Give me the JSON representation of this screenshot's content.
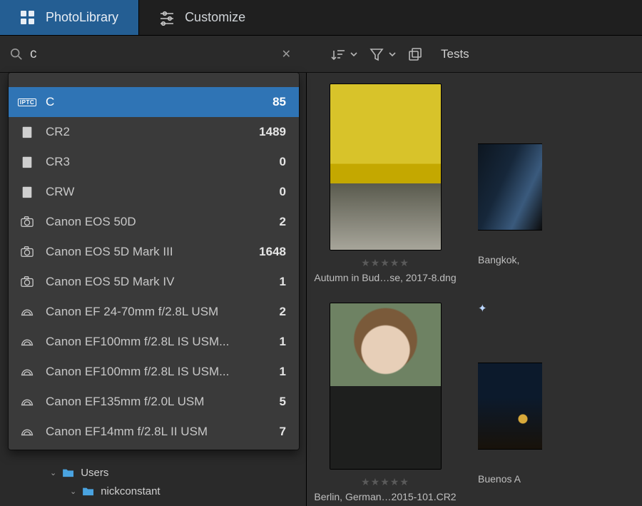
{
  "tabs": {
    "photolibrary": {
      "label": "PhotoLibrary"
    },
    "customize": {
      "label": "Customize"
    }
  },
  "search": {
    "value": "c",
    "placeholder": ""
  },
  "toolbar": {
    "breadcrumb": "Tests"
  },
  "suggestions": [
    {
      "icon": "iptc",
      "label": "C",
      "count": "85",
      "selected": true
    },
    {
      "icon": "file",
      "label": "CR2",
      "count": "1489"
    },
    {
      "icon": "file",
      "label": "CR3",
      "count": "0"
    },
    {
      "icon": "file",
      "label": "CRW",
      "count": "0"
    },
    {
      "icon": "camera",
      "label": "Canon EOS 50D",
      "count": "2"
    },
    {
      "icon": "camera",
      "label": "Canon EOS 5D Mark III",
      "count": "1648"
    },
    {
      "icon": "camera",
      "label": "Canon EOS 5D Mark IV",
      "count": "1"
    },
    {
      "icon": "lens",
      "label": "Canon EF 24-70mm f/2.8L USM",
      "count": "2"
    },
    {
      "icon": "lens",
      "label": "Canon EF100mm f/2.8L IS USM...",
      "count": "1"
    },
    {
      "icon": "lens",
      "label": "Canon EF100mm f/2.8L IS USM...",
      "count": "1"
    },
    {
      "icon": "lens",
      "label": "Canon EF135mm f/2.0L USM",
      "count": "5"
    },
    {
      "icon": "lens",
      "label": "Canon EF14mm f/2.8L II USM",
      "count": "7"
    }
  ],
  "tree": {
    "row1": "Users",
    "row2": "nickconstant"
  },
  "thumbs": [
    {
      "caption": "Autumn in Bud…se, 2017-8.dng",
      "shape": "portrait",
      "ph": "ph-autumn",
      "rated": true
    },
    {
      "caption": "Bangkok,",
      "shape": "landscape",
      "ph": "ph-bangkok",
      "rated": false,
      "partial": true
    },
    {
      "caption": "Berlin, German…2015-101.CR2",
      "shape": "portrait",
      "ph": "ph-man",
      "rated": true
    },
    {
      "caption": "Buenos A",
      "shape": "landscape",
      "ph": "ph-buenos",
      "rated": false,
      "partial": true,
      "spark": true
    }
  ],
  "stars_glyph": "★★★★★"
}
